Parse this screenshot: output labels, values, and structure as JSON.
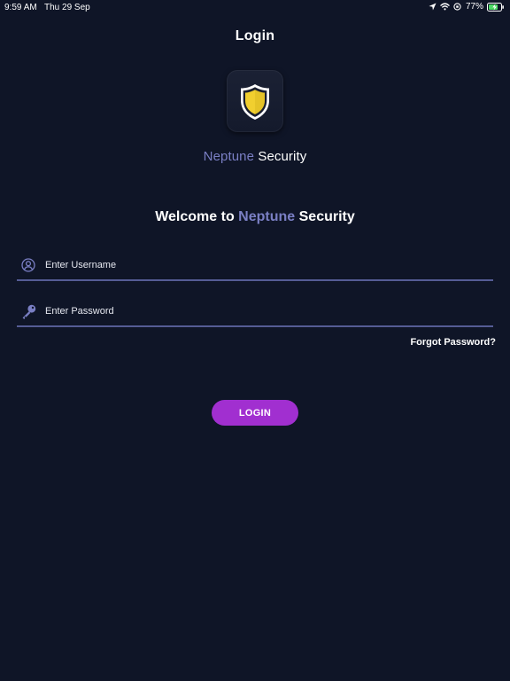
{
  "status_bar": {
    "time": "9:59 AM",
    "date": "Thu 29 Sep",
    "battery": "77%",
    "icons": [
      "location-arrow-icon",
      "wifi-icon",
      "orientation-lock-icon",
      "battery-charging-icon"
    ]
  },
  "header": {
    "title": "Login"
  },
  "brand": {
    "icon": "shield-icon",
    "name_accent": "Neptune",
    "name_rest": "Security",
    "colors": {
      "accent": "#7a7fc4",
      "shield_fill": "#f1cf2f",
      "background": "#0f1527"
    }
  },
  "welcome": {
    "prefix": "Welcome to",
    "accent": "Neptune",
    "suffix": "Security"
  },
  "form": {
    "username": {
      "icon": "user-icon",
      "placeholder": "Enter Username",
      "value": ""
    },
    "password": {
      "icon": "key-icon",
      "placeholder": "Enter Password",
      "value": ""
    },
    "forgot_label": "Forgot Password?",
    "login_label": "LOGIN",
    "login_color": "#a12fd0"
  }
}
